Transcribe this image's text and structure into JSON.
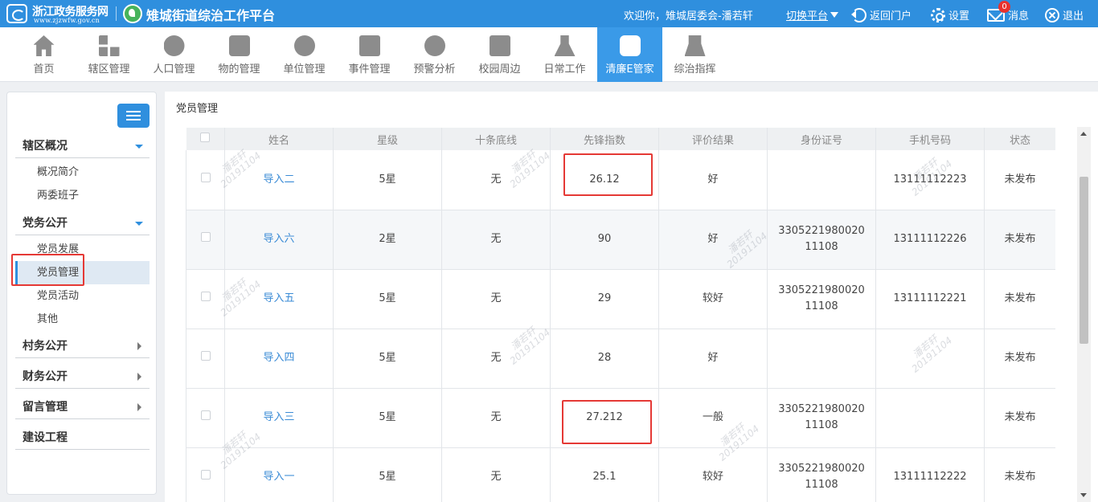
{
  "header": {
    "gov_title": "浙江政务服务网",
    "gov_url": "www.zjzwfw.gov.cn",
    "platform_title": "雉城街道综治工作平台",
    "welcome": "欢迎你，雉城居委会-潘若轩",
    "switch_platform": "切换平台",
    "return_portal": "返回门户",
    "settings": "设置",
    "messages": "消息",
    "message_count": "0",
    "logout": "退出"
  },
  "nav": {
    "items": [
      {
        "label": "首页",
        "icon": "home-icon"
      },
      {
        "label": "辖区管理",
        "icon": "grid-icon"
      },
      {
        "label": "人口管理",
        "icon": "people-icon"
      },
      {
        "label": "物的管理",
        "icon": "building-icon"
      },
      {
        "label": "单位管理",
        "icon": "unit-icon"
      },
      {
        "label": "事件管理",
        "icon": "event-icon"
      },
      {
        "label": "预警分析",
        "icon": "warning-icon"
      },
      {
        "label": "校园周边",
        "icon": "campus-icon"
      },
      {
        "label": "日常工作",
        "icon": "daily-work-icon"
      },
      {
        "label": "清廉E管家",
        "icon": "clean-manager-icon"
      },
      {
        "label": "综治指挥",
        "icon": "command-icon"
      }
    ],
    "active": "清廉E管家"
  },
  "sidebar": {
    "groups": {
      "overview": "辖区概况",
      "party": "党务公开",
      "village": "村务公开",
      "finance": "财务公开",
      "message": "留言管理",
      "construction": "建设工程"
    },
    "subs": {
      "intro": "概况简介",
      "committees": "两委班子",
      "member_dev": "党员发展",
      "member_mgmt": "党员管理",
      "member_act": "党员活动",
      "other": "其他"
    },
    "active": "党员管理"
  },
  "breadcrumb": "党员管理",
  "table": {
    "headers": {
      "name": "姓名",
      "star": "星级",
      "bottom_line": "十条底线",
      "index": "先锋指数",
      "eval": "评价结果",
      "id": "身份证号",
      "phone": "手机号码",
      "status": "状态"
    },
    "rows": [
      {
        "name": "导入二",
        "star": "5星",
        "bottom_line": "无",
        "index": "26.12",
        "eval": "好",
        "id": "",
        "phone": "13111112223",
        "status": "未发布"
      },
      {
        "name": "导入六",
        "star": "2星",
        "bottom_line": "无",
        "index": "90",
        "eval": "好",
        "id": "330522198002011108",
        "phone": "13111112226",
        "status": "未发布"
      },
      {
        "name": "导入五",
        "star": "5星",
        "bottom_line": "无",
        "index": "29",
        "eval": "较好",
        "id": "330522198002011108",
        "phone": "13111112221",
        "status": "未发布"
      },
      {
        "name": "导入四",
        "star": "5星",
        "bottom_line": "无",
        "index": "28",
        "eval": "好",
        "id": "",
        "phone": "",
        "status": "未发布"
      },
      {
        "name": "导入三",
        "star": "5星",
        "bottom_line": "无",
        "index": "27.212",
        "eval": "一般",
        "id": "330522198002011108",
        "phone": "",
        "status": "未发布"
      },
      {
        "name": "导入一",
        "star": "5星",
        "bottom_line": "无",
        "index": "25.1",
        "eval": "较好",
        "id": "330522198002011108",
        "phone": "13111112222",
        "status": "未发布"
      }
    ]
  },
  "watermark": {
    "name": "潘若轩",
    "date": "20191104"
  },
  "colors": {
    "primary": "#2f8fde",
    "active_nav": "#3a9ae8",
    "highlight": "#e53935",
    "link": "#3a8bd6"
  }
}
